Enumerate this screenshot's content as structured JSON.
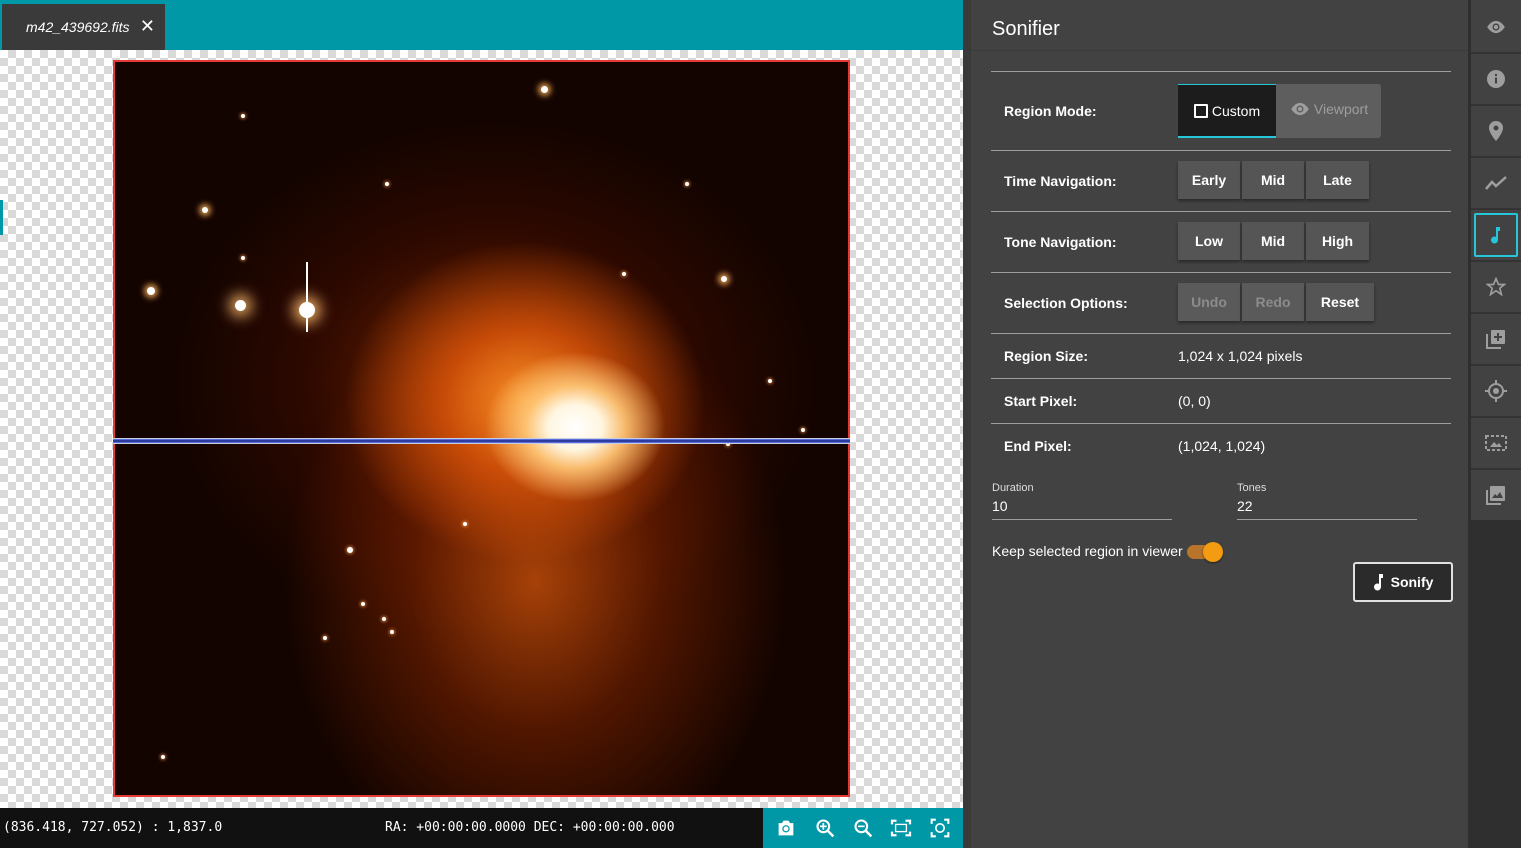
{
  "tab": {
    "filename": "m42_439692.fits",
    "close": "✕"
  },
  "status": {
    "coords": "(836.418, 727.052) : 1,837.0",
    "radec": "RA: +00:00:00.0000 DEC: +00:00:00.000"
  },
  "toolbar": [
    "camera-icon",
    "zoom-in-icon",
    "zoom-out-icon",
    "fit-screen-icon",
    "center-focus-icon"
  ],
  "panel": {
    "title": "Sonifier",
    "region_mode": {
      "label": "Region Mode:",
      "custom": "Custom",
      "viewport": "Viewport",
      "selected": "Custom"
    },
    "time_nav": {
      "label": "Time Navigation:",
      "early": "Early",
      "mid": "Mid",
      "late": "Late"
    },
    "tone_nav": {
      "label": "Tone Navigation:",
      "low": "Low",
      "mid": "Mid",
      "high": "High"
    },
    "selection": {
      "label": "Selection Options:",
      "undo": "Undo",
      "redo": "Redo",
      "reset": "Reset"
    },
    "region_size": {
      "label": "Region Size:",
      "value": "1,024 x 1,024 pixels"
    },
    "start_pixel": {
      "label": "Start Pixel:",
      "value": "(0, 0)"
    },
    "end_pixel": {
      "label": "End Pixel:",
      "value": "(1,024, 1,024)"
    },
    "duration": {
      "label": "Duration",
      "value": "10"
    },
    "tones": {
      "label": "Tones",
      "value": "22"
    },
    "keep_region": {
      "label": "Keep selected region in viewer",
      "enabled": true
    },
    "sonify": "Sonify"
  },
  "iconbar": [
    "eye-icon",
    "info-icon",
    "location-pin-icon",
    "chart-line-icon",
    "music-note-icon",
    "star-icon",
    "add-layer-icon",
    "target-icon",
    "image-area-icon",
    "gallery-icon"
  ],
  "colors": {
    "accent": "#0097a7",
    "active_border": "#26c6da",
    "toggle": "#f39c12",
    "region_border": "#e53935"
  }
}
